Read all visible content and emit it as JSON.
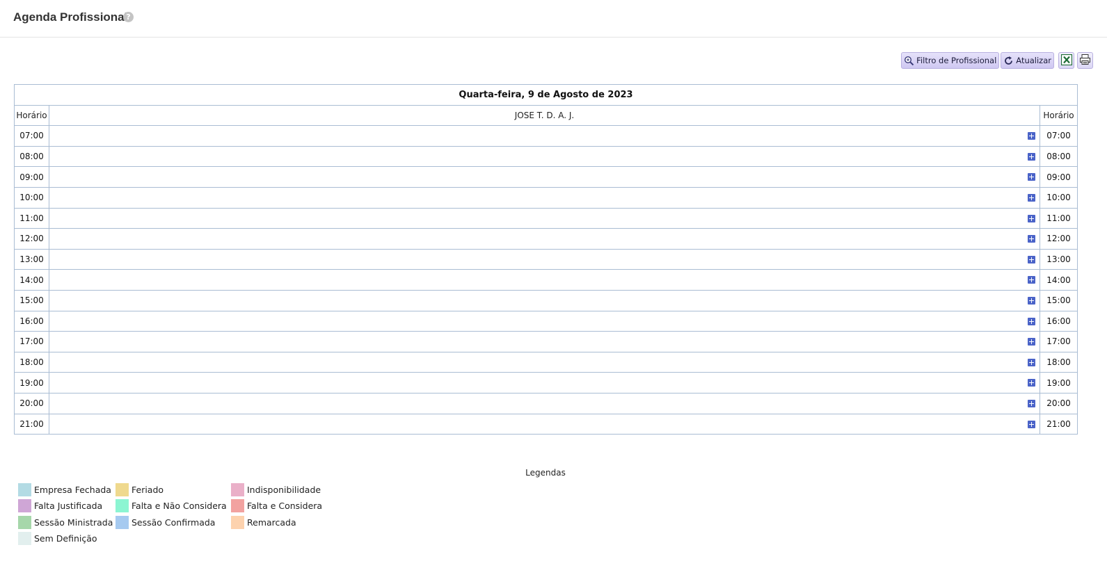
{
  "header": {
    "title": "Agenda Profissional",
    "help_icon": "?"
  },
  "toolbar": {
    "filter_label": "Filtro de Profissional",
    "refresh_label": "Atualizar",
    "excel_icon": "excel-icon",
    "print_icon": "printer-icon"
  },
  "agenda": {
    "date_title": "Quarta-feira, 9 de Agosto de 2023",
    "time_header": "Horário",
    "professional": "JOSE T. D. A. J.",
    "times": [
      "07:00",
      "08:00",
      "09:00",
      "10:00",
      "11:00",
      "12:00",
      "13:00",
      "14:00",
      "15:00",
      "16:00",
      "17:00",
      "18:00",
      "19:00",
      "20:00",
      "21:00"
    ]
  },
  "legend": {
    "title": "Legendas",
    "items": [
      {
        "label": "Empresa Fechada",
        "color": "#b3dbe4"
      },
      {
        "label": "Feriado",
        "color": "#efd98e"
      },
      {
        "label": "Indisponibilidade",
        "color": "#eab0c8"
      },
      {
        "label": "Falta Justificada",
        "color": "#cfa6d6"
      },
      {
        "label": "Falta e Não Considera",
        "color": "#8cf5d2"
      },
      {
        "label": "Falta e Considera",
        "color": "#f2a2a0"
      },
      {
        "label": "Sessão Ministrada",
        "color": "#a6d7aa"
      },
      {
        "label": "Sessão Confirmada",
        "color": "#a6caf0"
      },
      {
        "label": "Remarcada",
        "color": "#fdd2ae"
      },
      {
        "label": "Sem Definição",
        "color": "#e2efee"
      }
    ]
  },
  "colors": {
    "border": "#a9bcd3",
    "button_bg": "#d8d2f5",
    "add_icon": "#4a63c8"
  }
}
